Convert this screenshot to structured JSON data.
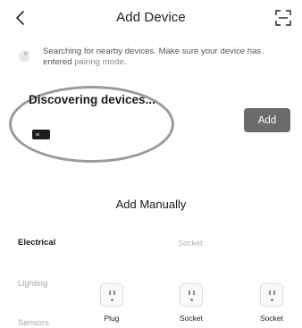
{
  "header": {
    "title": "Add Device",
    "back_icon": "chevron-left-icon",
    "scan_icon": "scan-icon"
  },
  "search": {
    "text_main": "Searching for nearby devices. Make sure your device has entered ",
    "link": "pairing mode",
    "text_end": "."
  },
  "discovery": {
    "title": "Discovering devices...",
    "add_label": "Add",
    "add_button_color": "#6b6b6b"
  },
  "manual": {
    "title": "Add Manually",
    "categories": [
      "Electrical",
      "Lighting",
      "Sensors"
    ],
    "section_label": "Socket",
    "products": [
      {
        "label": "Plug"
      },
      {
        "label": "Socket"
      },
      {
        "label": "Socket"
      }
    ]
  }
}
